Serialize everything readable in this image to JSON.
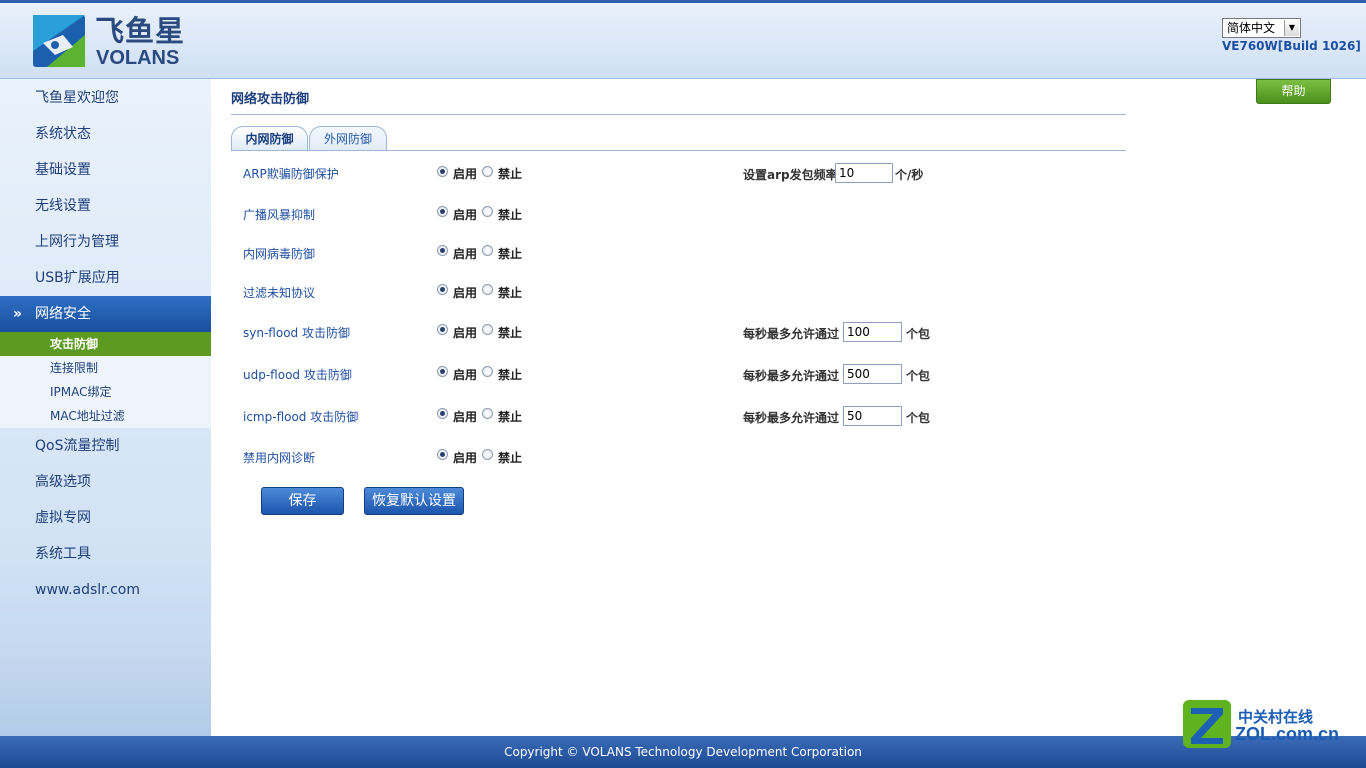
{
  "header": {
    "brand_cn": "飞鱼星",
    "brand_en": "VOLANS",
    "language": "简体中文",
    "build": "VE760W[Build 1026]"
  },
  "sidebar": {
    "items": [
      {
        "label": "飞鱼星欢迎您"
      },
      {
        "label": "系统状态"
      },
      {
        "label": "基础设置"
      },
      {
        "label": "无线设置"
      },
      {
        "label": "上网行为管理"
      },
      {
        "label": "USB扩展应用"
      },
      {
        "label": "网络安全"
      },
      {
        "label": "QoS流量控制"
      },
      {
        "label": "高级选项"
      },
      {
        "label": "虚拟专网"
      },
      {
        "label": "系统工具"
      },
      {
        "label": "www.adslr.com"
      }
    ],
    "subitems": [
      {
        "label": "攻击防御"
      },
      {
        "label": "连接限制"
      },
      {
        "label": "IPMAC绑定"
      },
      {
        "label": "MAC地址过滤"
      }
    ]
  },
  "main": {
    "title": "网络攻击防御",
    "help": "帮助",
    "tabs": [
      {
        "label": "内网防御"
      },
      {
        "label": "外网防御"
      }
    ],
    "enable_label": "启用",
    "disable_label": "禁止",
    "rows": [
      {
        "label": "ARP欺骗防御保护",
        "enabled": true,
        "extra_label": "设置arp发包频率",
        "value": "10",
        "unit": "个/秒"
      },
      {
        "label": "广播风暴抑制",
        "enabled": true
      },
      {
        "label": "内网病毒防御",
        "enabled": true
      },
      {
        "label": "过滤未知协议",
        "enabled": true
      },
      {
        "label": "syn-flood 攻击防御",
        "enabled": true,
        "extra_label": "每秒最多允许通过",
        "value": "100",
        "unit": "个包"
      },
      {
        "label": "udp-flood 攻击防御",
        "enabled": true,
        "extra_label": "每秒最多允许通过",
        "value": "500",
        "unit": "个包"
      },
      {
        "label": "icmp-flood 攻击防御",
        "enabled": true,
        "extra_label": "每秒最多允许通过",
        "value": "50",
        "unit": "个包"
      },
      {
        "label": "禁用内网诊断",
        "enabled": true
      }
    ],
    "save_label": "保存",
    "restore_label": "恢复默认设置"
  },
  "footer": {
    "copyright": "Copyright © VOLANS Technology Development Corporation"
  },
  "watermark": {
    "cn": "中关村在线",
    "en": "ZOL.com.cn"
  },
  "colors": {
    "primary_blue": "#1a4f9e",
    "active_green": "#5c9a22",
    "help_green": "#5fa32a"
  }
}
